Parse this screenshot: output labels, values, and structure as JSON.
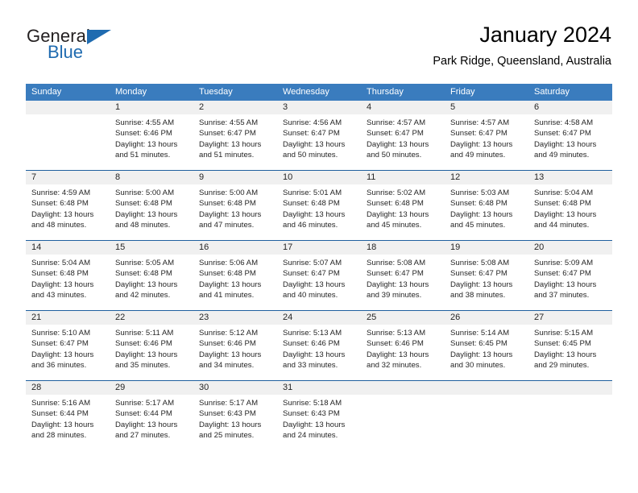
{
  "brand": {
    "name_part1": "General",
    "name_part2": "Blue",
    "accent_color": "#1f6bb0"
  },
  "header": {
    "title": "January 2024",
    "subtitle": "Park Ridge, Queensland, Australia"
  },
  "theme": {
    "header_band": "#3a7cbe",
    "week_divider": "#1f5f9e",
    "daynum_band": "#f0f0f0",
    "text": "#262626"
  },
  "weekdays": [
    "Sunday",
    "Monday",
    "Tuesday",
    "Wednesday",
    "Thursday",
    "Friday",
    "Saturday"
  ],
  "weeks": [
    [
      {
        "day": "",
        "lines": []
      },
      {
        "day": "1",
        "lines": [
          "Sunrise: 4:55 AM",
          "Sunset: 6:46 PM",
          "Daylight: 13 hours",
          "and 51 minutes."
        ]
      },
      {
        "day": "2",
        "lines": [
          "Sunrise: 4:55 AM",
          "Sunset: 6:47 PM",
          "Daylight: 13 hours",
          "and 51 minutes."
        ]
      },
      {
        "day": "3",
        "lines": [
          "Sunrise: 4:56 AM",
          "Sunset: 6:47 PM",
          "Daylight: 13 hours",
          "and 50 minutes."
        ]
      },
      {
        "day": "4",
        "lines": [
          "Sunrise: 4:57 AM",
          "Sunset: 6:47 PM",
          "Daylight: 13 hours",
          "and 50 minutes."
        ]
      },
      {
        "day": "5",
        "lines": [
          "Sunrise: 4:57 AM",
          "Sunset: 6:47 PM",
          "Daylight: 13 hours",
          "and 49 minutes."
        ]
      },
      {
        "day": "6",
        "lines": [
          "Sunrise: 4:58 AM",
          "Sunset: 6:47 PM",
          "Daylight: 13 hours",
          "and 49 minutes."
        ]
      }
    ],
    [
      {
        "day": "7",
        "lines": [
          "Sunrise: 4:59 AM",
          "Sunset: 6:48 PM",
          "Daylight: 13 hours",
          "and 48 minutes."
        ]
      },
      {
        "day": "8",
        "lines": [
          "Sunrise: 5:00 AM",
          "Sunset: 6:48 PM",
          "Daylight: 13 hours",
          "and 48 minutes."
        ]
      },
      {
        "day": "9",
        "lines": [
          "Sunrise: 5:00 AM",
          "Sunset: 6:48 PM",
          "Daylight: 13 hours",
          "and 47 minutes."
        ]
      },
      {
        "day": "10",
        "lines": [
          "Sunrise: 5:01 AM",
          "Sunset: 6:48 PM",
          "Daylight: 13 hours",
          "and 46 minutes."
        ]
      },
      {
        "day": "11",
        "lines": [
          "Sunrise: 5:02 AM",
          "Sunset: 6:48 PM",
          "Daylight: 13 hours",
          "and 45 minutes."
        ]
      },
      {
        "day": "12",
        "lines": [
          "Sunrise: 5:03 AM",
          "Sunset: 6:48 PM",
          "Daylight: 13 hours",
          "and 45 minutes."
        ]
      },
      {
        "day": "13",
        "lines": [
          "Sunrise: 5:04 AM",
          "Sunset: 6:48 PM",
          "Daylight: 13 hours",
          "and 44 minutes."
        ]
      }
    ],
    [
      {
        "day": "14",
        "lines": [
          "Sunrise: 5:04 AM",
          "Sunset: 6:48 PM",
          "Daylight: 13 hours",
          "and 43 minutes."
        ]
      },
      {
        "day": "15",
        "lines": [
          "Sunrise: 5:05 AM",
          "Sunset: 6:48 PM",
          "Daylight: 13 hours",
          "and 42 minutes."
        ]
      },
      {
        "day": "16",
        "lines": [
          "Sunrise: 5:06 AM",
          "Sunset: 6:48 PM",
          "Daylight: 13 hours",
          "and 41 minutes."
        ]
      },
      {
        "day": "17",
        "lines": [
          "Sunrise: 5:07 AM",
          "Sunset: 6:47 PM",
          "Daylight: 13 hours",
          "and 40 minutes."
        ]
      },
      {
        "day": "18",
        "lines": [
          "Sunrise: 5:08 AM",
          "Sunset: 6:47 PM",
          "Daylight: 13 hours",
          "and 39 minutes."
        ]
      },
      {
        "day": "19",
        "lines": [
          "Sunrise: 5:08 AM",
          "Sunset: 6:47 PM",
          "Daylight: 13 hours",
          "and 38 minutes."
        ]
      },
      {
        "day": "20",
        "lines": [
          "Sunrise: 5:09 AM",
          "Sunset: 6:47 PM",
          "Daylight: 13 hours",
          "and 37 minutes."
        ]
      }
    ],
    [
      {
        "day": "21",
        "lines": [
          "Sunrise: 5:10 AM",
          "Sunset: 6:47 PM",
          "Daylight: 13 hours",
          "and 36 minutes."
        ]
      },
      {
        "day": "22",
        "lines": [
          "Sunrise: 5:11 AM",
          "Sunset: 6:46 PM",
          "Daylight: 13 hours",
          "and 35 minutes."
        ]
      },
      {
        "day": "23",
        "lines": [
          "Sunrise: 5:12 AM",
          "Sunset: 6:46 PM",
          "Daylight: 13 hours",
          "and 34 minutes."
        ]
      },
      {
        "day": "24",
        "lines": [
          "Sunrise: 5:13 AM",
          "Sunset: 6:46 PM",
          "Daylight: 13 hours",
          "and 33 minutes."
        ]
      },
      {
        "day": "25",
        "lines": [
          "Sunrise: 5:13 AM",
          "Sunset: 6:46 PM",
          "Daylight: 13 hours",
          "and 32 minutes."
        ]
      },
      {
        "day": "26",
        "lines": [
          "Sunrise: 5:14 AM",
          "Sunset: 6:45 PM",
          "Daylight: 13 hours",
          "and 30 minutes."
        ]
      },
      {
        "day": "27",
        "lines": [
          "Sunrise: 5:15 AM",
          "Sunset: 6:45 PM",
          "Daylight: 13 hours",
          "and 29 minutes."
        ]
      }
    ],
    [
      {
        "day": "28",
        "lines": [
          "Sunrise: 5:16 AM",
          "Sunset: 6:44 PM",
          "Daylight: 13 hours",
          "and 28 minutes."
        ]
      },
      {
        "day": "29",
        "lines": [
          "Sunrise: 5:17 AM",
          "Sunset: 6:44 PM",
          "Daylight: 13 hours",
          "and 27 minutes."
        ]
      },
      {
        "day": "30",
        "lines": [
          "Sunrise: 5:17 AM",
          "Sunset: 6:43 PM",
          "Daylight: 13 hours",
          "and 25 minutes."
        ]
      },
      {
        "day": "31",
        "lines": [
          "Sunrise: 5:18 AM",
          "Sunset: 6:43 PM",
          "Daylight: 13 hours",
          "and 24 minutes."
        ]
      },
      {
        "day": "",
        "lines": []
      },
      {
        "day": "",
        "lines": []
      },
      {
        "day": "",
        "lines": []
      }
    ]
  ]
}
